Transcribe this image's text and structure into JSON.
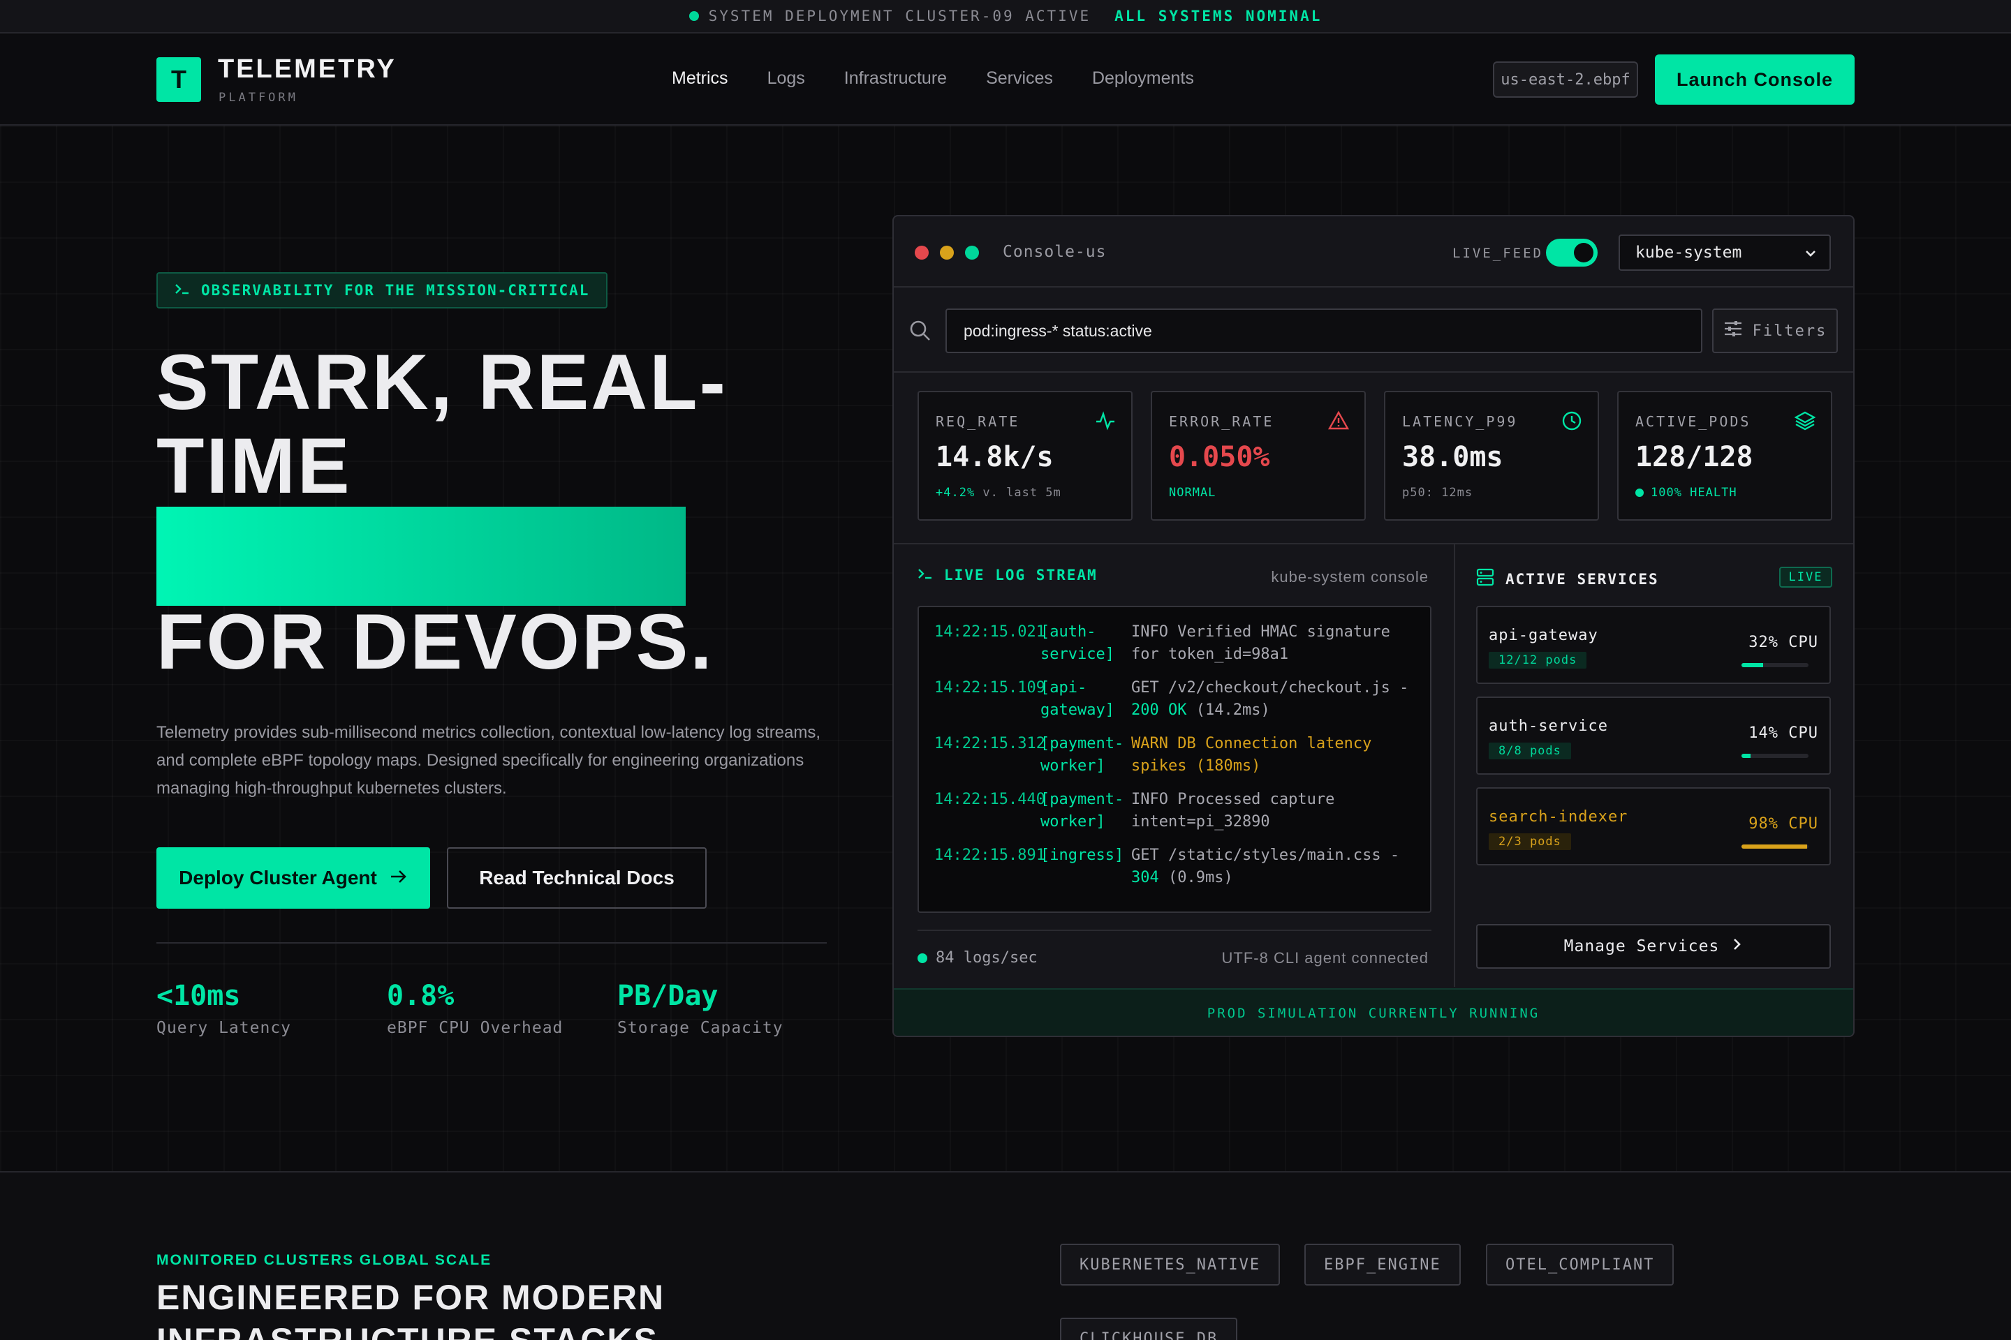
{
  "topbar": {
    "status": "SYSTEM DEPLOYMENT CLUSTER-09 ACTIVE",
    "health": "ALL SYSTEMS NOMINAL"
  },
  "header": {
    "logo_letter": "T",
    "title": "TELEMETRY",
    "subtitle": "PLATFORM",
    "nav": [
      "Metrics",
      "Logs",
      "Infrastructure",
      "Services",
      "Deployments"
    ],
    "region": "us-east-2.ebpf",
    "launch_label": "Launch Console"
  },
  "hero": {
    "tagline": "OBSERVABILITY FOR THE MISSION-CRITICAL",
    "title_line1": "STARK, REAL-",
    "title_line2": "TIME",
    "title_line3": "FOR DEVOPS.",
    "description": "Telemetry provides sub-millisecond metrics collection, contextual low-latency log streams, and complete eBPF topology maps. Designed specifically for engineering organizations managing high-throughput kubernetes clusters.",
    "primary_cta": "Deploy Cluster Agent",
    "secondary_cta": "Read Technical Docs",
    "stats": [
      {
        "value": "<10ms",
        "label": "Query Latency"
      },
      {
        "value": "0.8%",
        "label": "eBPF CPU Overhead"
      },
      {
        "value": "PB/Day",
        "label": "Storage Capacity"
      }
    ]
  },
  "console": {
    "title": "Console-us",
    "live_feed_label": "LIVE_FEED",
    "live_feed_on": true,
    "namespace": "kube-system",
    "search_value": "pod:ingress-* status:active",
    "filters_label": "Filters",
    "metrics": [
      {
        "label": "REQ_RATE",
        "value": "14.8k/s",
        "sub": "+4.2% v. last 5m",
        "icon": "activity-icon"
      },
      {
        "label": "ERROR_RATE",
        "value": "0.050%",
        "sub": "NORMAL",
        "icon": "alert-triangle-icon"
      },
      {
        "label": "LATENCY_P99",
        "value": "38.0ms",
        "sub": "p50: 12ms",
        "icon": "clock-icon"
      },
      {
        "label": "ACTIVE_PODS",
        "value": "128/128",
        "sub": "100% HEALTH",
        "icon": "layers-icon"
      }
    ],
    "log_stream": {
      "title": "LIVE LOG STREAM",
      "context": "kube-system console",
      "entries": [
        {
          "time": "14:22:15.021",
          "source": "[auth-service]",
          "message": "INFO Verified HMAC signature for token_id=98a1"
        },
        {
          "time": "14:22:15.109",
          "source": "[api-gateway]",
          "message": "GET /v2/checkout/checkout.js -",
          "status": "200 OK",
          "duration": "(14.2ms)"
        },
        {
          "time": "14:22:15.312",
          "source": "[payment-worker]",
          "message": "WARN DB Connection latency spikes (180ms)"
        },
        {
          "time": "14:22:15.440",
          "source": "[payment-worker]",
          "message": "INFO Processed capture intent=pi_32890"
        },
        {
          "time": "14:22:15.891",
          "source": "[ingress]",
          "message": "GET /static/styles/main.css -",
          "status": "304",
          "duration": "(0.9ms)"
        }
      ],
      "rate": "84 logs/sec",
      "agent": "UTF-8 CLI agent connected"
    },
    "services": {
      "title": "ACTIVE SERVICES",
      "badge": "LIVE",
      "items": [
        {
          "name": "api-gateway",
          "pods": "12/12 pods",
          "cpu": "32% CPU",
          "cpu_fraction": 0.32
        },
        {
          "name": "auth-service",
          "pods": "8/8 pods",
          "cpu": "14% CPU",
          "cpu_fraction": 0.14
        },
        {
          "name": "search-indexer",
          "pods": "2/3 pods",
          "cpu": "98% CPU",
          "cpu_fraction": 0.98
        }
      ],
      "manage_label": "Manage Services"
    },
    "banner": "PROD SIMULATION CURRENTLY RUNNING"
  },
  "lower": {
    "eyebrow": "MONITORED CLUSTERS GLOBAL SCALE",
    "title": "ENGINEERED FOR MODERN INFRASTRUCTURE STACKS",
    "tags": [
      "KUBERNETES_NATIVE",
      "EBPF_ENGINE",
      "OTEL_COMPLIANT",
      "CLICKHOUSE_DB"
    ]
  },
  "colors": {
    "accent": "#00e5a5",
    "warn": "#d9a21b",
    "error": "#e5484d",
    "background": "#0b0b0d"
  }
}
